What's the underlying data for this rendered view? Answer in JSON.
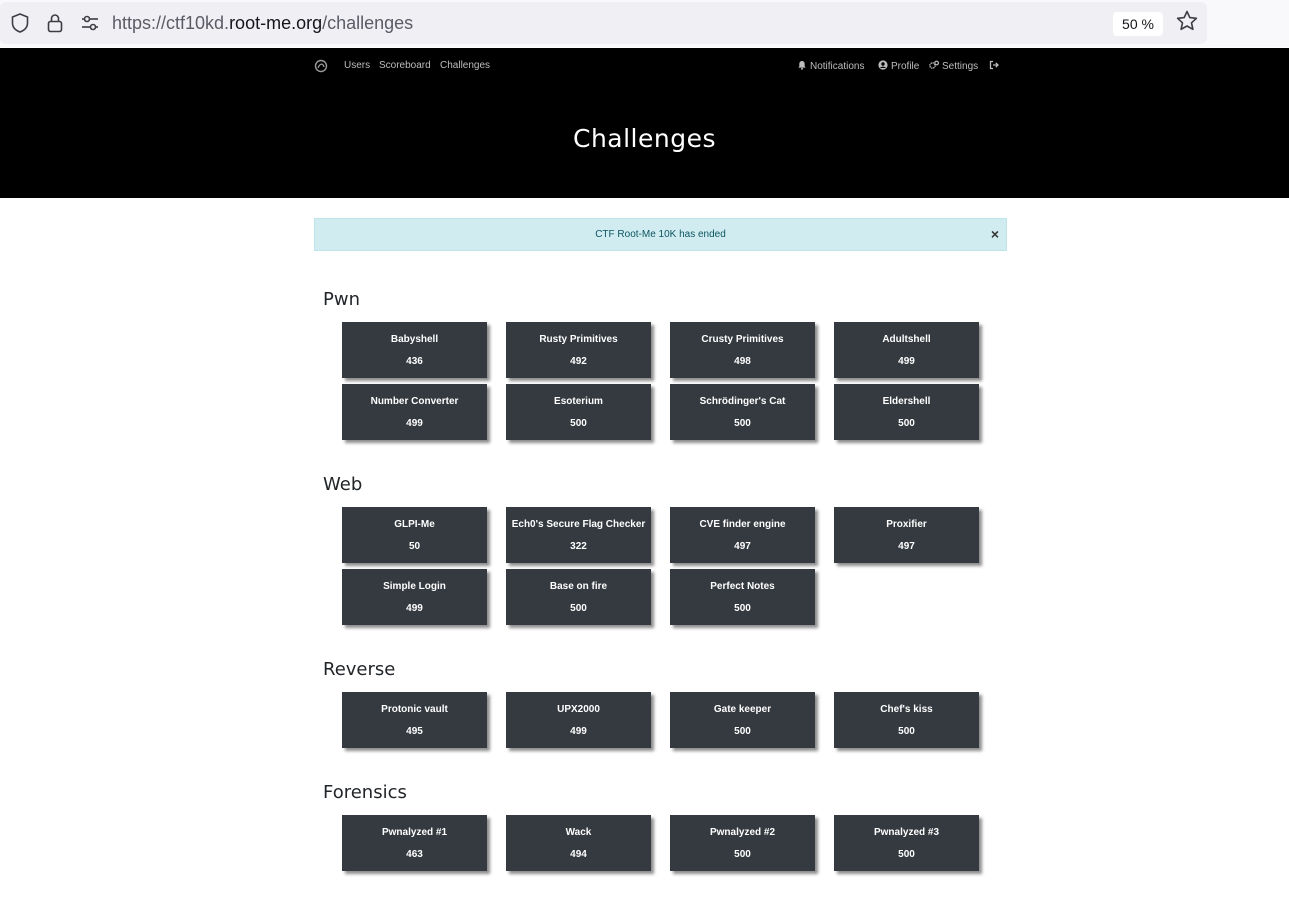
{
  "browser": {
    "url_prefix": "https://ctf10kd.",
    "url_domain": "root-me.org",
    "url_path": "/challenges",
    "zoom": "50 %"
  },
  "nav": {
    "users": "Users",
    "scoreboard": "Scoreboard",
    "challenges": "Challenges",
    "notifications": "Notifications",
    "profile": "Profile",
    "settings": "Settings"
  },
  "page": {
    "title": "Challenges"
  },
  "alert": {
    "text": "CTF Root-Me 10K has ended",
    "close": "×"
  },
  "categories": [
    {
      "name": "Pwn",
      "challenges": [
        {
          "name": "Babyshell",
          "points": "436"
        },
        {
          "name": "Rusty Primitives",
          "points": "492"
        },
        {
          "name": "Crusty Primitives",
          "points": "498"
        },
        {
          "name": "Adultshell",
          "points": "499"
        },
        {
          "name": "Number Converter",
          "points": "499"
        },
        {
          "name": "Esoterium",
          "points": "500"
        },
        {
          "name": "Schrödinger's Cat",
          "points": "500"
        },
        {
          "name": "Eldershell",
          "points": "500"
        }
      ]
    },
    {
      "name": "Web",
      "challenges": [
        {
          "name": "GLPI-Me",
          "points": "50"
        },
        {
          "name": "Ech0's Secure Flag Checker",
          "points": "322"
        },
        {
          "name": "CVE finder engine",
          "points": "497"
        },
        {
          "name": "Proxifier",
          "points": "497"
        },
        {
          "name": "Simple Login",
          "points": "499"
        },
        {
          "name": "Base on fire",
          "points": "500"
        },
        {
          "name": "Perfect Notes",
          "points": "500"
        }
      ]
    },
    {
      "name": "Reverse",
      "challenges": [
        {
          "name": "Protonic vault",
          "points": "495"
        },
        {
          "name": "UPX2000",
          "points": "499"
        },
        {
          "name": "Gate keeper",
          "points": "500"
        },
        {
          "name": "Chef's kiss",
          "points": "500"
        }
      ]
    },
    {
      "name": "Forensics",
      "challenges": [
        {
          "name": "Pwnalyzed #1",
          "points": "463"
        },
        {
          "name": "Wack",
          "points": "494"
        },
        {
          "name": "Pwnalyzed #2",
          "points": "500"
        },
        {
          "name": "Pwnalyzed #3",
          "points": "500"
        }
      ]
    }
  ]
}
